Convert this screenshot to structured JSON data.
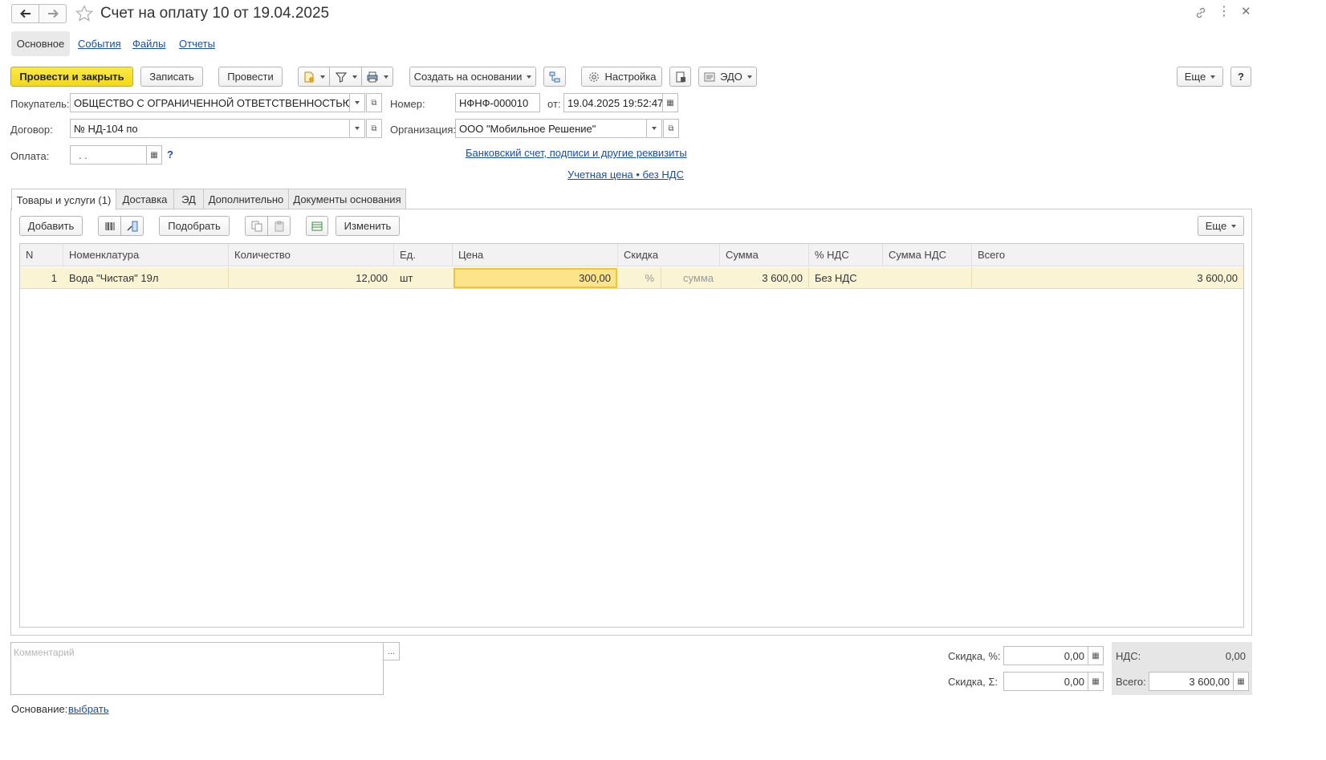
{
  "window": {
    "title": "Счет на оплату 10 от 19.04.2025"
  },
  "nav_tabs": [
    {
      "label": "Основное"
    },
    {
      "label": "События"
    },
    {
      "label": "Файлы"
    },
    {
      "label": "Отчеты"
    }
  ],
  "toolbar": {
    "post_close_label": "Провести и закрыть",
    "save_label": "Записать",
    "post_label": "Провести",
    "create_based_label": "Создать на основании",
    "settings_label": "Настройка",
    "edo_label": "ЭДО",
    "more_label": "Еще",
    "help_label": "?"
  },
  "form": {
    "buyer_label": "Покупатель:",
    "buyer_value": "ОБЩЕСТВО С ОГРАНИЧЕННОЙ ОТВЕТСТВЕННОСТЬЮ \"Д",
    "contract_label": "Договор:",
    "contract_value": "№ НД-104 по",
    "payment_label": "Оплата:",
    "payment_value": " .  .",
    "payment_help": "?",
    "number_label": "Номер:",
    "number_value": "НФНФ-000010",
    "date_label": "от:",
    "date_value": "19.04.2025 19:52:47",
    "org_label": "Организация:",
    "org_value": "ООО \"Мобильное Решение\"",
    "bank_link": "Банковский счет, подписи и другие реквизиты",
    "price_link": "Учетная цена • без НДС"
  },
  "doc_tabs": [
    {
      "label": "Товары и услуги (1)"
    },
    {
      "label": "Доставка"
    },
    {
      "label": "ЭД"
    },
    {
      "label": "Дополнительно"
    },
    {
      "label": "Документы основания"
    }
  ],
  "table_toolbar": {
    "add_label": "Добавить",
    "pick_label": "Подобрать",
    "change_label": "Изменить",
    "more_label": "Еще"
  },
  "table": {
    "columns": [
      "N",
      "Номенклатура",
      "Количество",
      "Ед.",
      "Цена",
      "Скидка",
      "Сумма",
      "% НДС",
      "Сумма НДС",
      "Всего"
    ],
    "rows": [
      {
        "n": "1",
        "item": "Вода \"Чистая\" 19л",
        "qty": "12,000",
        "unit": "шт",
        "price": "300,00",
        "discount_pct": "%",
        "discount_sum": "сумма",
        "sum": "3 600,00",
        "vat_rate": "Без НДС",
        "vat_sum": "",
        "total": "3 600,00"
      }
    ]
  },
  "footer": {
    "comment_placeholder": "Комментарий",
    "ellipsis": "...",
    "discount_pct_label": "Скидка, %:",
    "discount_pct_value": "0,00",
    "discount_sum_label": "Скидка, Σ:",
    "discount_sum_value": "0,00",
    "vat_label": "НДС:",
    "vat_value": "0,00",
    "total_label": "Всего:",
    "total_value": "3 600,00",
    "basis_label": "Основание:",
    "basis_link": "выбрать"
  }
}
